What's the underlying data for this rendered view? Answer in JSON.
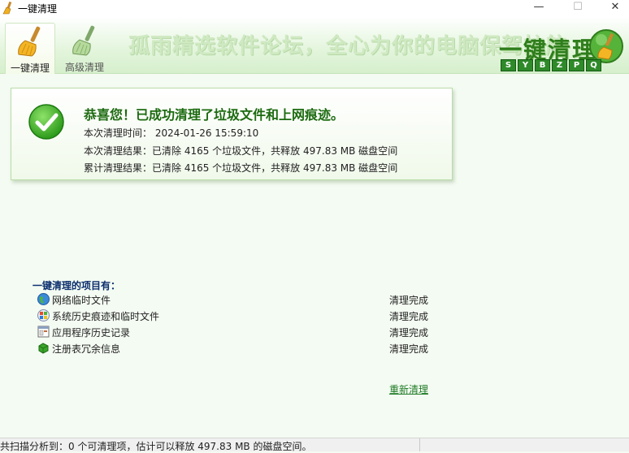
{
  "window": {
    "title": "一键清理",
    "min": "—",
    "max": "☐",
    "close": "✕"
  },
  "tabs": [
    {
      "label": "一键清理"
    },
    {
      "label": "高级清理"
    }
  ],
  "header": {
    "slogan": "孤雨精选软件论坛，全心为你的电脑保驾护航",
    "brand": "一键清理",
    "letters": [
      "S",
      "Y",
      "B",
      "Z",
      "P",
      "Q"
    ]
  },
  "result": {
    "title": "恭喜您！已成功清理了垃圾文件和上网痕迹。",
    "time_line": "本次清理时间：  2024-01-26 15:59:10",
    "this_line": "本次清理结果：已清除 4165 个垃圾文件，共释放 497.83 MB 磁盘空间",
    "total_line": "累计清理结果：已清除 4165 个垃圾文件，共释放 497.83 MB 磁盘空间"
  },
  "items_heading": "一键清理的项目有：",
  "items": [
    {
      "name": "网络临时文件",
      "status": "清理完成",
      "icon": "globe-icon"
    },
    {
      "name": "系统历史痕迹和临时文件",
      "status": "清理完成",
      "icon": "windows-icon"
    },
    {
      "name": "应用程序历史记录",
      "status": "清理完成",
      "icon": "app-window-icon"
    },
    {
      "name": "注册表冗余信息",
      "status": "清理完成",
      "icon": "registry-cube-icon"
    }
  ],
  "redo_link": "重新清理",
  "statusbar": {
    "text": "共扫描分析到：0 个可清理项，估计可以释放 497.83 MB 的磁盘空间。"
  },
  "colors": {
    "accent_green": "#2f7d1c",
    "background": "#f4fbf2",
    "heading_blue": "#0b2e6e"
  }
}
